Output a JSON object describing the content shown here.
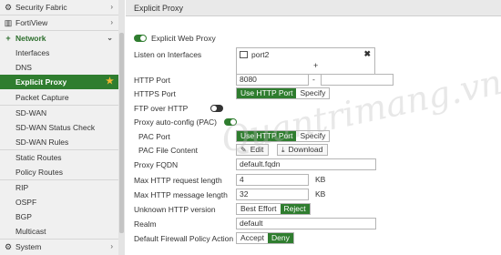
{
  "sidebar": {
    "security_fabric": "Security Fabric",
    "fortiview": "FortiView",
    "network": "Network",
    "items": [
      "Interfaces",
      "DNS",
      "Explicit Proxy",
      "Packet Capture",
      "SD-WAN",
      "SD-WAN Status Check",
      "SD-WAN Rules",
      "Static Routes",
      "Policy Routes",
      "RIP",
      "OSPF",
      "BGP",
      "Multicast"
    ],
    "system": "System"
  },
  "header": {
    "title": "Explicit Proxy"
  },
  "form": {
    "explicit_web_proxy": "Explicit Web Proxy",
    "listen_on_interfaces": "Listen on Interfaces",
    "interface_value": "port2",
    "add_symbol": "+",
    "remove_symbol": "✖",
    "http_port": "HTTP Port",
    "http_port_value": "8080",
    "http_port_dash": "-",
    "https_port": "HTTPS Port",
    "use_http_port": "Use HTTP Port",
    "specify": "Specify",
    "ftp_over_http": "FTP over HTTP",
    "pac": "Proxy auto-config (PAC)",
    "pac_port": "PAC Port",
    "pac_file_content": "PAC File Content",
    "edit": "Edit",
    "download": "Download",
    "proxy_fqdn": "Proxy FQDN",
    "proxy_fqdn_value": "default.fqdn",
    "max_req_len": "Max HTTP request length",
    "max_req_len_value": "4",
    "max_msg_len": "Max HTTP message length",
    "max_msg_len_value": "32",
    "kb": "KB",
    "unknown_http_version": "Unknown HTTP version",
    "best_effort": "Best Effort",
    "reject": "Reject",
    "realm": "Realm",
    "realm_value": "default",
    "default_fw_action": "Default Firewall Policy Action",
    "accept": "Accept",
    "deny": "Deny"
  },
  "watermark": "Quantrimang.vn",
  "colors": {
    "accent": "#2f7d2f",
    "sidebar_bg": "#f0f0f0",
    "header_bg": "#e9e9e9"
  }
}
